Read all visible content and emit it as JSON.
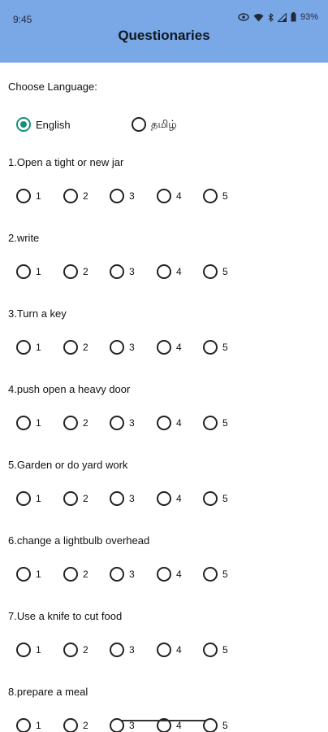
{
  "status_bar": {
    "time": "9:45",
    "battery": "93%"
  },
  "header": {
    "title": "Questionaries"
  },
  "language": {
    "label": "Choose Language:",
    "options": [
      {
        "label": "English",
        "selected": true
      },
      {
        "label": "தமிழ்",
        "selected": false
      }
    ]
  },
  "scale": [
    "1",
    "2",
    "3",
    "4",
    "5"
  ],
  "questions": [
    {
      "text": "1.Open a tight or new jar"
    },
    {
      "text": "2.write"
    },
    {
      "text": "3.Turn a key"
    },
    {
      "text": "4.push open a heavy door"
    },
    {
      "text": "5.Garden or do yard work"
    },
    {
      "text": "6.change a lightbulb overhead"
    },
    {
      "text": "7.Use a knife to cut food"
    },
    {
      "text": "8.prepare a meal"
    }
  ],
  "colors": {
    "appbar": "#7aa7e6",
    "radio_selected": "#16907a"
  }
}
